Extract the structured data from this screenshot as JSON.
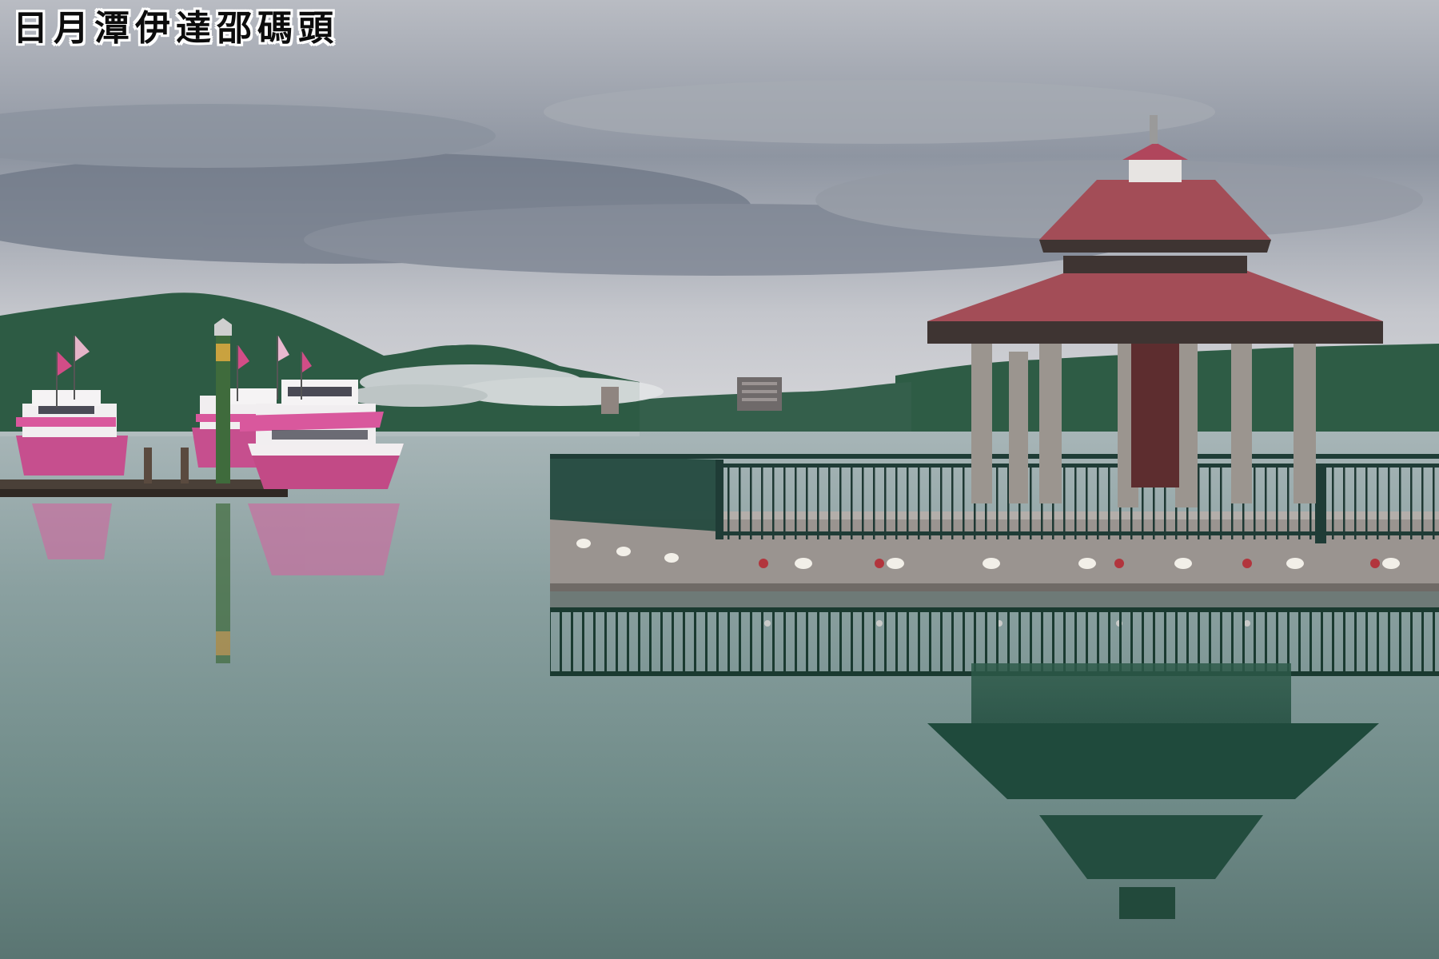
{
  "image": {
    "caption": "日月潭伊達邵碼頭",
    "scene": {
      "sky_color": "#c9ccd2",
      "cloud_color": "#6c7585",
      "mountain_color": "#2f5f45",
      "water_color": "#7e9796",
      "roof_color": "#a34d57",
      "boat_accent": "#c64f8e"
    }
  }
}
